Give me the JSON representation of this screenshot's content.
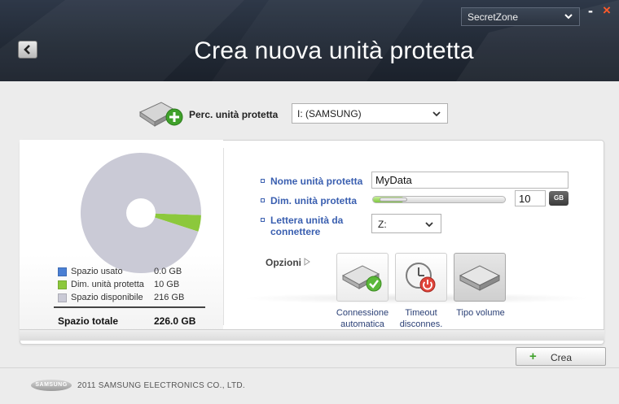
{
  "window": {
    "title": "Crea nuova unità protetta",
    "zone_selector": "SecretZone",
    "minimize_glyph": "-",
    "close_glyph": "×"
  },
  "path": {
    "label": "Perc. unità protetta",
    "selected": "I: (SAMSUNG)"
  },
  "disk_summary": {
    "legend": [
      {
        "label": "Spazio usato",
        "value": "0.0 GB",
        "color": "#4a7fd4"
      },
      {
        "label": "Dim. unità protetta",
        "value": "10 GB",
        "color": "#8cc83c"
      },
      {
        "label": "Spazio disponibile",
        "value": "216 GB",
        "color": "#cacad6"
      }
    ],
    "total_label": "Spazio totale",
    "total_value": "226.0 GB"
  },
  "chart_data": {
    "type": "pie",
    "categories": [
      "Spazio usato",
      "Dim. unità protetta",
      "Spazio disponibile"
    ],
    "values": [
      0.0,
      10,
      216
    ],
    "colors": [
      "#4a7fd4",
      "#8cc83c",
      "#cacad6"
    ]
  },
  "form": {
    "name_label": "Nome unità protetta",
    "name_value": "MyData",
    "size_label": "Dim. unità protetta",
    "size_value": "10",
    "size_slider_fraction": 0.05,
    "size_unit": "GB",
    "letter_label": "Lettera unità da connettere",
    "letter_value": "Z:"
  },
  "options": {
    "label": "Opzioni",
    "tiles": [
      {
        "caption": "Connessione automatica",
        "icon": "drive-check-icon"
      },
      {
        "caption": "Timeout disconnes.",
        "icon": "clock-power-icon"
      },
      {
        "caption": "Tipo volume",
        "icon": "drive-icon",
        "selected": true
      }
    ]
  },
  "actions": {
    "create_label": "Crea"
  },
  "footer": {
    "logo_text": "SAMSUNG",
    "copyright": "2011 SAMSUNG ELECTRONICS CO., LTD."
  }
}
